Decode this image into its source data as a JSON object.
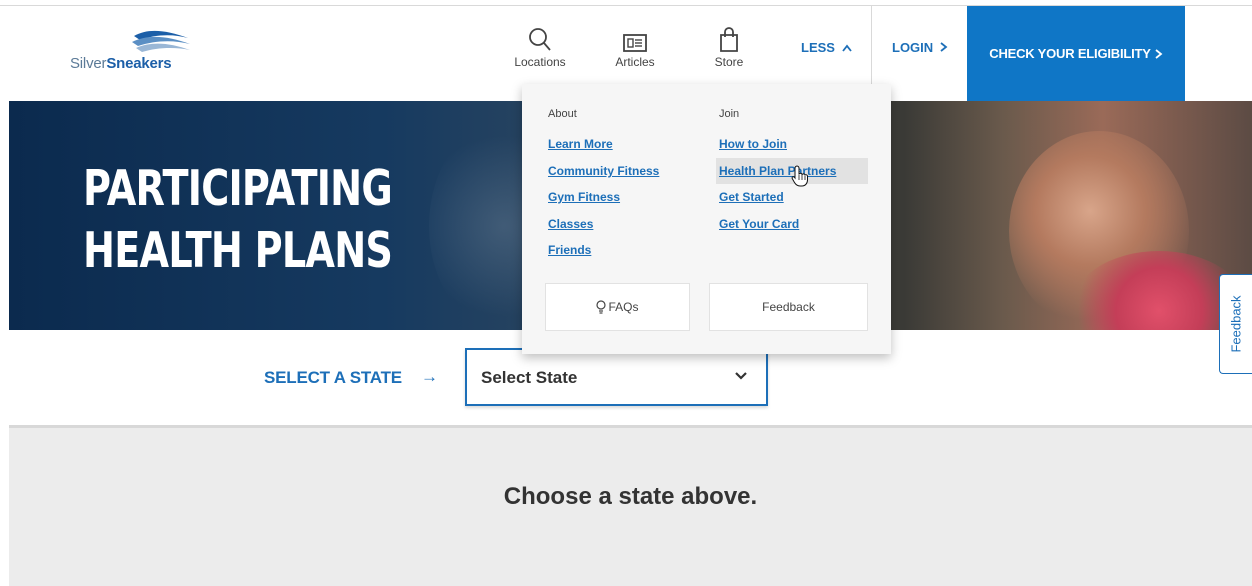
{
  "header": {
    "logo": {
      "part1": "Silver",
      "part2": "Sneakers"
    },
    "nav": [
      {
        "label": "Locations",
        "icon": "search-icon"
      },
      {
        "label": "Articles",
        "icon": "newspaper-icon"
      },
      {
        "label": "Store",
        "icon": "shopping-bag-icon"
      }
    ],
    "less_label": "LESS",
    "login_label": "LOGIN",
    "cta_label": "CHECK YOUR ELIGIBILITY"
  },
  "hero": {
    "line1": "PARTICIPATING",
    "line2": "HEALTH PLANS"
  },
  "dropdown": {
    "about_heading": "About",
    "about_links": [
      "Learn More",
      "Community Fitness",
      "Gym Fitness",
      "Classes",
      "Friends"
    ],
    "join_heading": "Join",
    "join_links": [
      "How to Join",
      "Health Plan Partners",
      "Get Started",
      "Get Your Card"
    ],
    "faqs_label": "FAQs",
    "feedback_label": "Feedback"
  },
  "side_tab": {
    "label": "Feedback"
  },
  "state_select": {
    "label": "SELECT A STATE",
    "value": "Select State"
  },
  "message": "Choose a state above.",
  "colors": {
    "brand_blue": "#1d6fb8",
    "cta_blue": "#0f76c6",
    "hero_navy": "#0b2a4e"
  }
}
